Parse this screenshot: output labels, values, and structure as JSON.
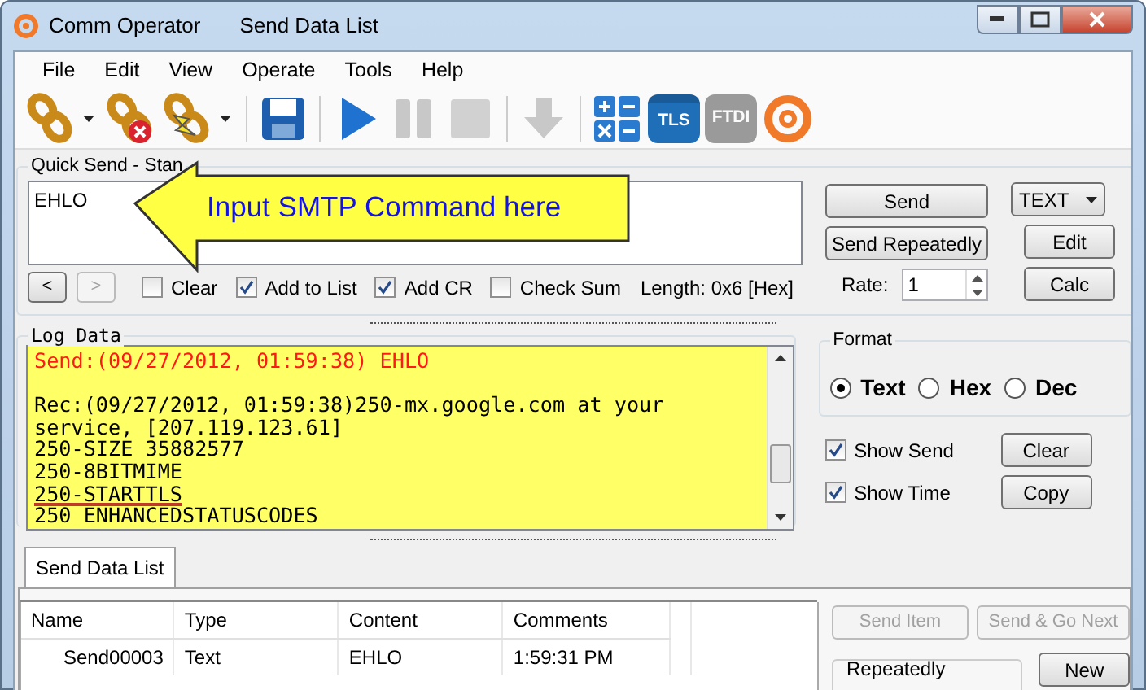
{
  "window": {
    "app_title": "Comm Operator",
    "document_title": "Send Data List"
  },
  "menu": [
    "File",
    "Edit",
    "View",
    "Operate",
    "Tools",
    "Help"
  ],
  "toolbar": [
    {
      "kind": "connect",
      "dropdown": true,
      "disabled": false
    },
    {
      "kind": "disconnect",
      "dropdown": false,
      "disabled": false
    },
    {
      "kind": "reconnect",
      "dropdown": true,
      "disabled": false
    },
    {
      "kind": "sep"
    },
    {
      "kind": "save",
      "disabled": false
    },
    {
      "kind": "sep"
    },
    {
      "kind": "play",
      "disabled": false
    },
    {
      "kind": "pause",
      "disabled": true
    },
    {
      "kind": "stop",
      "disabled": true
    },
    {
      "kind": "sep"
    },
    {
      "kind": "down",
      "disabled": true
    },
    {
      "kind": "sep"
    },
    {
      "kind": "calc",
      "disabled": false
    },
    {
      "kind": "tls",
      "label": "TLS",
      "disabled": false
    },
    {
      "kind": "ftdi",
      "label": "FTDI",
      "disabled": true
    },
    {
      "kind": "logo",
      "disabled": false
    }
  ],
  "quick_send": {
    "title": "Quick Send - Stan",
    "input": "EHLO",
    "nav": [
      {
        "label": "<",
        "disabled": false
      },
      {
        "label": ">",
        "disabled": true
      }
    ],
    "options": [
      {
        "label": "Clear",
        "checked": false
      },
      {
        "label": "Add to List",
        "checked": true
      },
      {
        "label": "Add CR",
        "checked": true
      },
      {
        "label": "Check Sum",
        "checked": false
      }
    ],
    "length": "Length: 0x6 [Hex]",
    "send": "Send",
    "send_repeatedly": "Send Repeatedly",
    "rate_label": "Rate:",
    "rate": "1",
    "format": "TEXT",
    "edit": "Edit",
    "calc": "Calc"
  },
  "callout": {
    "text": "Input SMTP Command here"
  },
  "log": {
    "title": "Log Data",
    "lines": [
      {
        "kind": "send",
        "text": "Send:(09/27/2012, 01:59:38) EHLO"
      },
      {
        "kind": "blank"
      },
      {
        "kind": "recv",
        "text": "Rec:(09/27/2012, 01:59:38)250-mx.google.com at your"
      },
      {
        "kind": "recv",
        "text": "service, [207.119.123.61]"
      },
      {
        "kind": "recv",
        "text": "250-SIZE 35882577"
      },
      {
        "kind": "recv",
        "text": "250-8BITMIME"
      },
      {
        "kind": "recv",
        "text": "250-STARTTLS",
        "underlined": true
      },
      {
        "kind": "recv",
        "text": "250 ENHANCEDSTATUSCODES"
      }
    ]
  },
  "format": {
    "title": "Format",
    "options": [
      {
        "label": "Text",
        "selected": true
      },
      {
        "label": "Hex",
        "selected": false
      },
      {
        "label": "Dec",
        "selected": false
      }
    ],
    "show": [
      {
        "label": "Show Send",
        "checked": true,
        "button": "Clear"
      },
      {
        "label": "Show Time",
        "checked": true,
        "button": "Copy"
      }
    ]
  },
  "tabs": [
    {
      "label": "Send Data List",
      "selected": true
    }
  ],
  "table": {
    "columns": [
      "Name",
      "Type",
      "Content",
      "Comments"
    ],
    "rows": [
      [
        "Send00003",
        "Text",
        "EHLO",
        "1:59:31 PM"
      ]
    ]
  },
  "list_actions": [
    {
      "label": "Send Item",
      "disabled": true
    },
    {
      "label": "Send & Go Next",
      "disabled": true
    }
  ],
  "repeatedly": {
    "title": "Repeatedly"
  },
  "new_button": "New"
}
